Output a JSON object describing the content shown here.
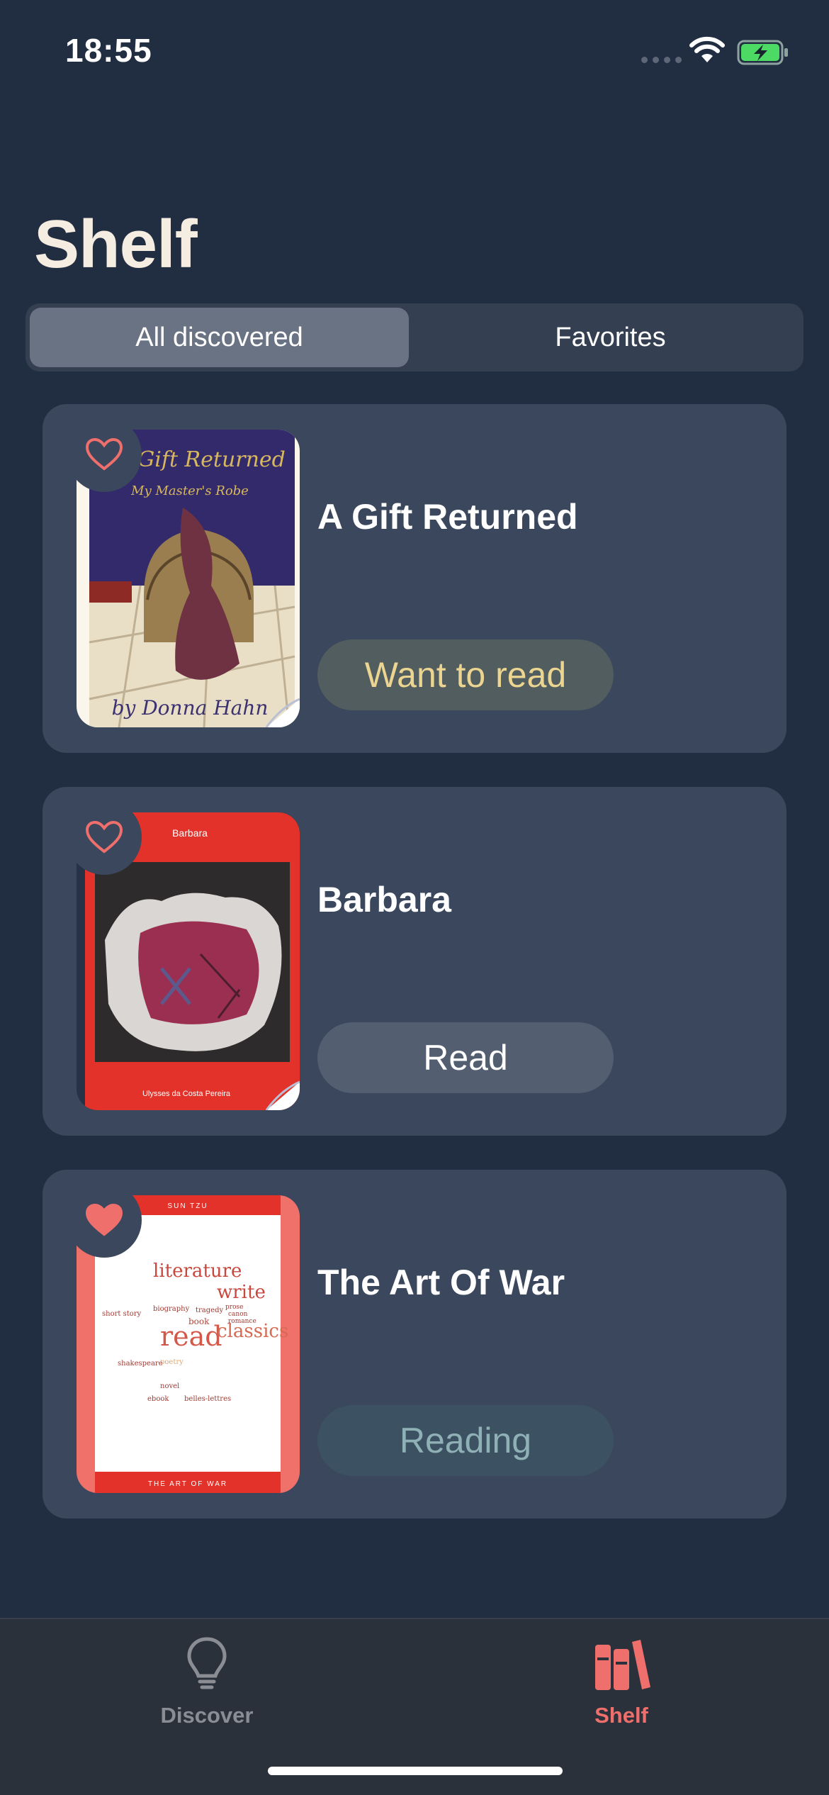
{
  "status_bar": {
    "time": "18:55"
  },
  "header": {
    "title": "Shelf"
  },
  "segmented": {
    "all_label": "All discovered",
    "favorites_label": "Favorites"
  },
  "books": [
    {
      "title": "A Gift Returned",
      "status": "Want to read",
      "favorite": false,
      "cover_text": {
        "title": "A Gift Returned",
        "subtitle": "My Master's Robe",
        "author": "by Donna Hahn"
      }
    },
    {
      "title": "Barbara",
      "status": "Read",
      "favorite": false,
      "cover_text": {
        "title": "Barbara",
        "author": "Ulysses da Costa Pereira"
      }
    },
    {
      "title": "The Art Of War",
      "status": "Reading",
      "favorite": true,
      "cover_text": {
        "top": "SUN TZU",
        "bottom": "THE ART OF WAR",
        "words": [
          "literature",
          "write",
          "read",
          "classics",
          "short story",
          "biography",
          "tragedy",
          "book",
          "shakespeare",
          "novel",
          "poetry",
          "prose",
          "ebook",
          "romance",
          "canon",
          "belles-lettres"
        ]
      }
    }
  ],
  "tabs": [
    {
      "label": "Discover",
      "icon": "lightbulb-icon",
      "active": false
    },
    {
      "label": "Shelf",
      "icon": "books-icon",
      "active": true
    }
  ],
  "colors": {
    "background": "#212d40",
    "card": "#3a475c",
    "accent": "#ef6f6c",
    "want_to_read": "#ebd590",
    "reading": "#8fb1b6"
  }
}
